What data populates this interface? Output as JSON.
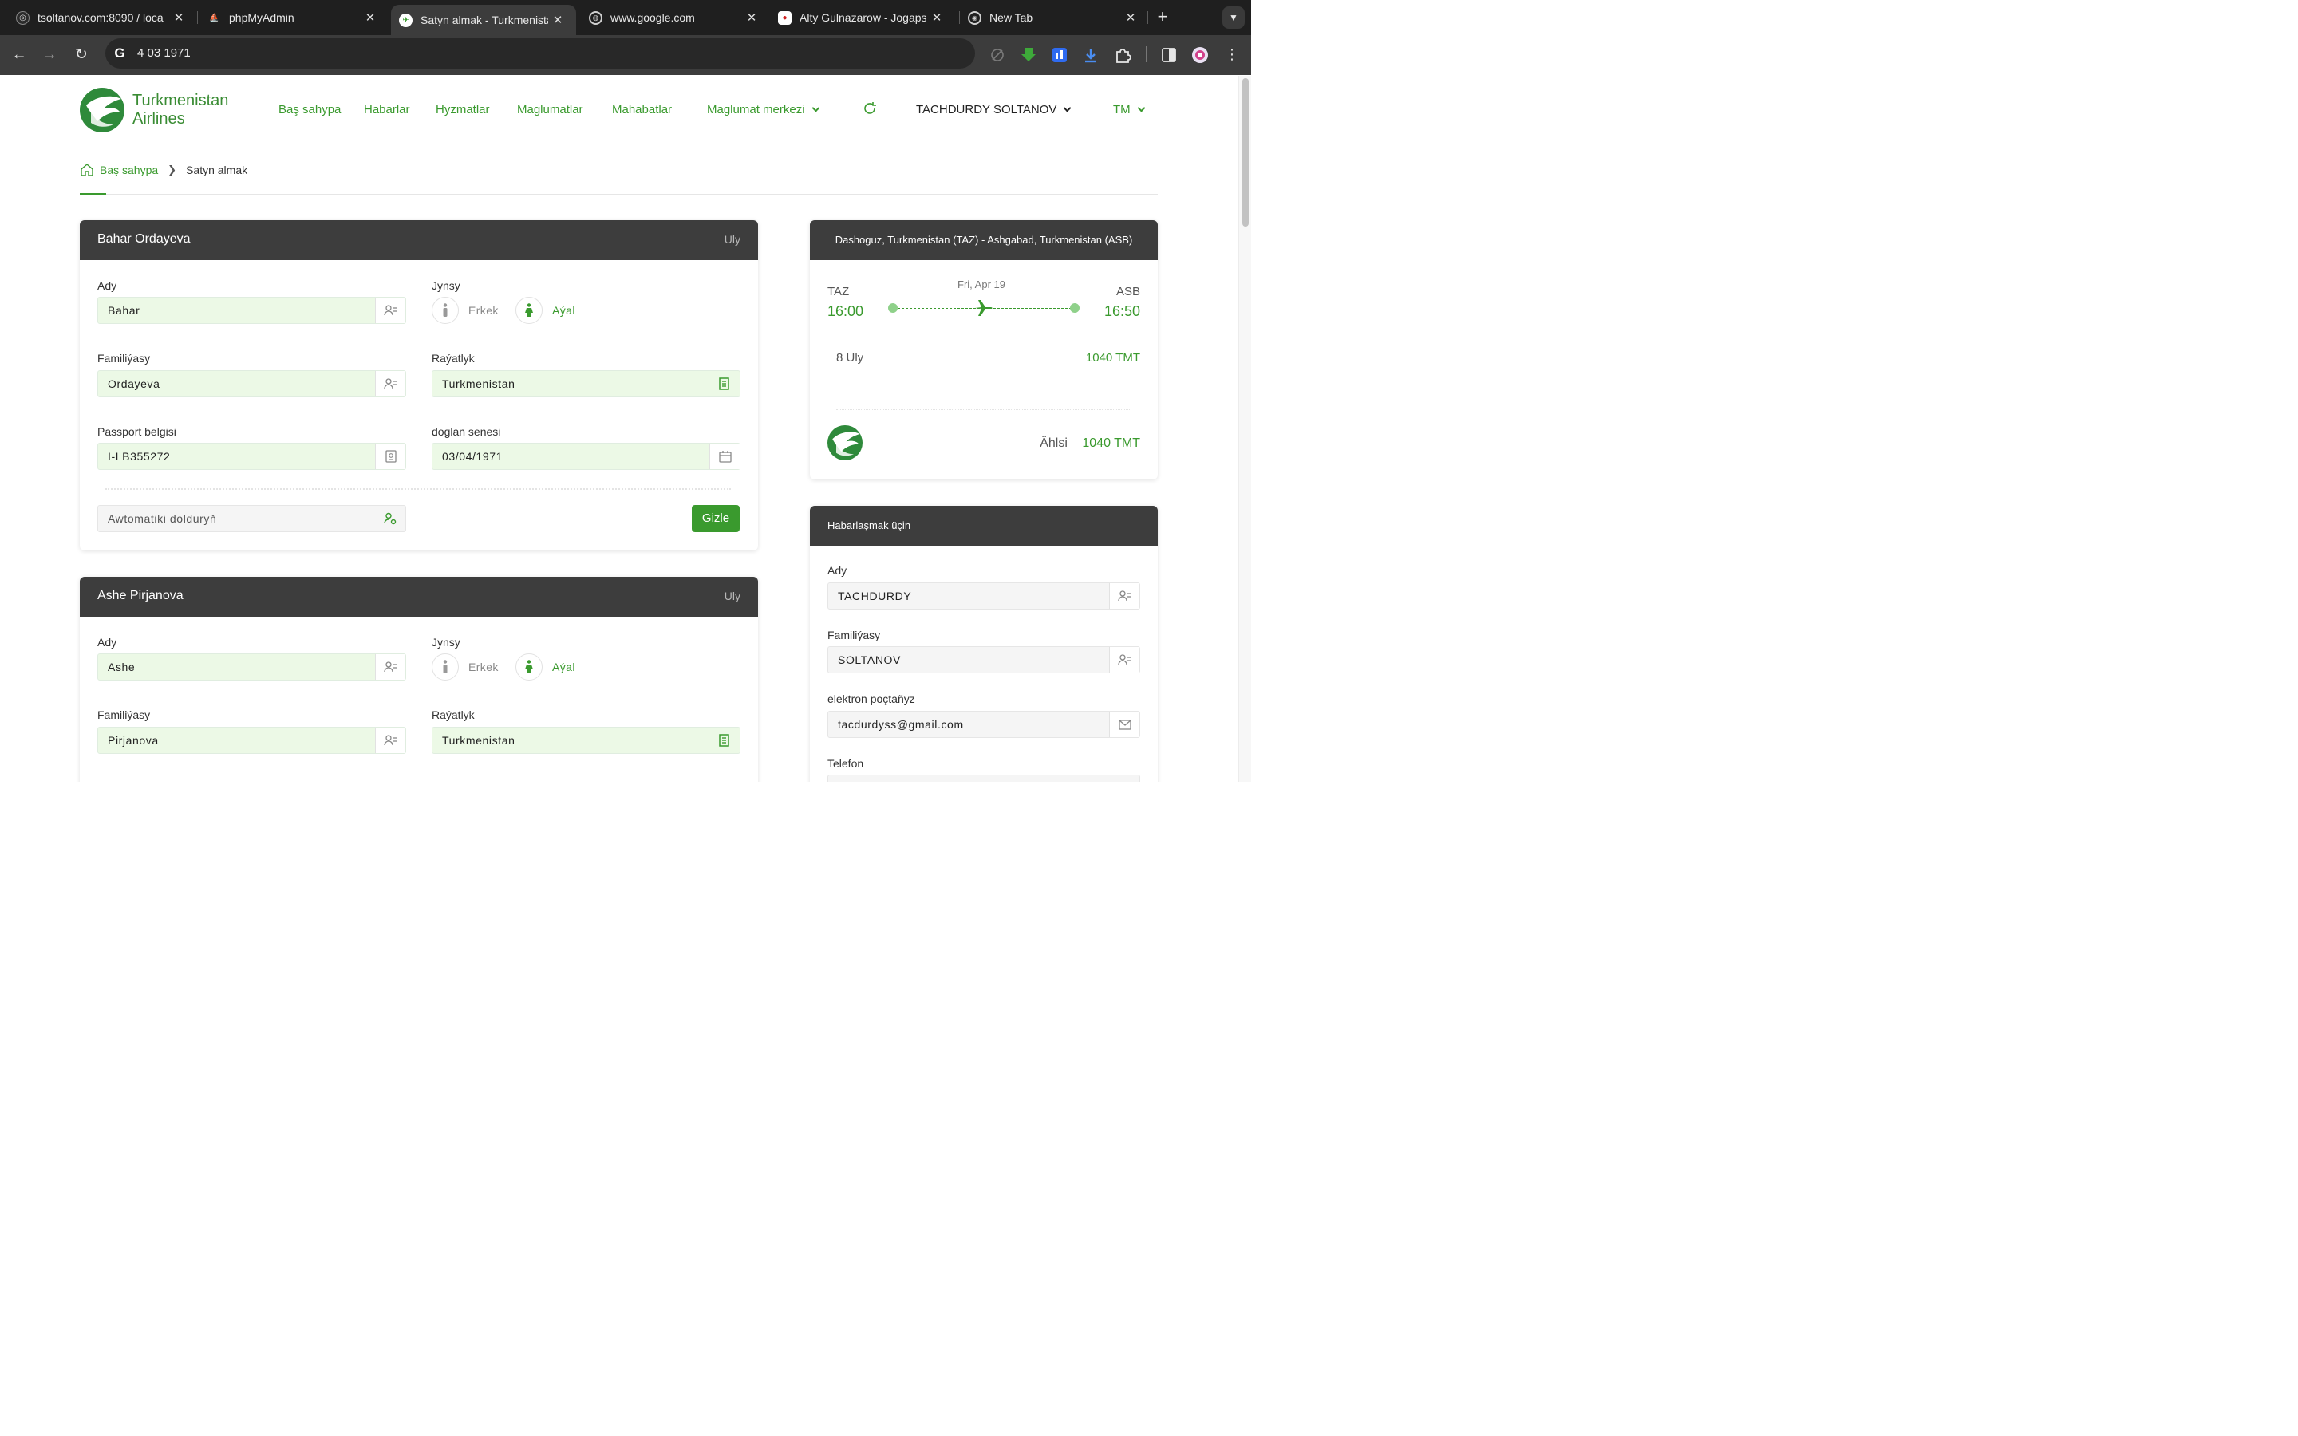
{
  "browser": {
    "tabs": [
      {
        "title": "tsoltanov.com:8090 / loca",
        "active": false
      },
      {
        "title": "phpMyAdmin",
        "active": false
      },
      {
        "title": "Satyn almak - Turkmenista",
        "active": true
      },
      {
        "title": "www.google.com",
        "active": false
      },
      {
        "title": "Alty Gulnazarow - Jogaps",
        "active": false
      },
      {
        "title": "New Tab",
        "active": false
      }
    ],
    "address": "4 03 1971"
  },
  "site": {
    "brand_line1": "Turkmenistan",
    "brand_line2": "Airlines",
    "nav": [
      "Baş sahypa",
      "Habarlar",
      "Hyzmatlar",
      "Maglumatlar",
      "Mahabatlar",
      "Maglumat merkezi"
    ],
    "user": "TACHDURDY SOLTANOV",
    "lang": "TM"
  },
  "breadcrumb": {
    "home": "Baş sahypa",
    "current": "Satyn almak"
  },
  "passengers": [
    {
      "name": "Bahar Ordayeva",
      "type": "Uly",
      "labels": {
        "first": "Ady",
        "gender": "Jynsy",
        "last": "Familiýasy",
        "citizenship": "Raýatlyk",
        "passport": "Passport belgisi",
        "dob": "doglan senesi"
      },
      "first": "Bahar",
      "last": "Ordayeva",
      "citizenship": "Turkmenistan",
      "passport": "I-LB355272",
      "dob": "03/04/1971",
      "gender_male": "Erkek",
      "gender_female": "Aýal",
      "autofill": "Awtomatiki dolduryň",
      "hide_btn": "Gizle"
    },
    {
      "name": "Ashe Pirjanova",
      "type": "Uly",
      "labels": {
        "first": "Ady",
        "gender": "Jynsy",
        "last": "Familiýasy",
        "citizenship": "Raýatlyk"
      },
      "first": "Ashe",
      "last": "Pirjanova",
      "citizenship": "Turkmenistan",
      "gender_male": "Erkek",
      "gender_female": "Aýal"
    }
  ],
  "flight": {
    "route": "Dashoguz, Turkmenistan (TAZ) - Ashgabad, Turkmenistan (ASB)",
    "from_code": "TAZ",
    "to_code": "ASB",
    "date": "Fri, Apr 19",
    "dep_time": "16:00",
    "arr_time": "16:50",
    "pax_summary": "8 Uly",
    "pax_price": "1040 TMT",
    "total_label": "Ählsi",
    "total_price": "1040 TMT"
  },
  "contact": {
    "title": "Habarlaşmak üçin",
    "first_label": "Ady",
    "first": "TACHDURDY",
    "last_label": "Familiýasy",
    "last": "SOLTANOV",
    "email_label": "elektron poçtaňyz",
    "email": "tacdurdyss@gmail.com",
    "phone_label": "Telefon"
  },
  "colors": {
    "accent": "#3a9a2e",
    "header_dark": "#3d3d3d",
    "field_bg": "#ecf9e6"
  }
}
